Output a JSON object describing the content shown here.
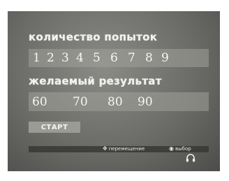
{
  "attempts": {
    "label": "количество попыток",
    "options": [
      "1",
      "2",
      "3",
      "4",
      "5",
      "6",
      "7",
      "8",
      "9"
    ]
  },
  "result": {
    "label": "желаемый результат",
    "options": [
      "60",
      "70",
      "80",
      "90"
    ]
  },
  "start_label": "СТАРТ",
  "hints": {
    "move_icon": "dpad-icon",
    "move_label": "перемещение",
    "select_icon": "circle-button-icon",
    "select_label": "выбор"
  },
  "colors": {
    "panel": "#6b6c68",
    "text": "#f2f2ee",
    "bar": "#a0a09a",
    "button": "#9b9b96",
    "bottom_bar": "#373834"
  }
}
